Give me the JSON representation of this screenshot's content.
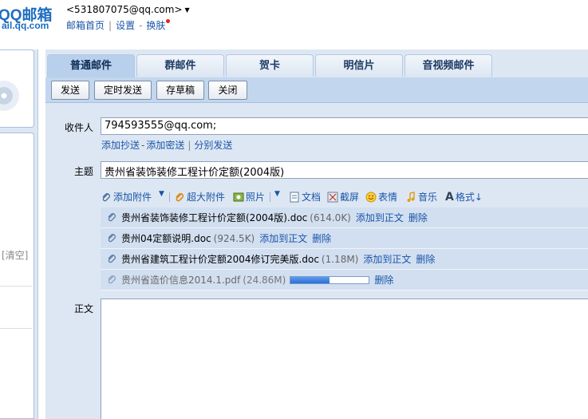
{
  "header": {
    "logo_main": "QQ邮箱",
    "logo_sub": "ail.qq.com",
    "account": "<531807075@qq.com>",
    "links": [
      "邮箱首页",
      "设置",
      "换肤"
    ]
  },
  "sidebar": {
    "clear_label": "[清空]"
  },
  "tabs": [
    {
      "label": "普通邮件",
      "active": true
    },
    {
      "label": "群邮件",
      "active": false
    },
    {
      "label": "贺卡",
      "active": false
    },
    {
      "label": "明信片",
      "active": false
    },
    {
      "label": "音视频邮件",
      "active": false
    }
  ],
  "toolbar": {
    "send": "发送",
    "scheduled_send": "定时发送",
    "save_draft": "存草稿",
    "close": "关闭"
  },
  "compose": {
    "to_label": "收件人",
    "to_value": "794593555@qq.com;",
    "to_links": [
      "添加抄送",
      "添加密送",
      "分别发送"
    ],
    "subject_label": "主题",
    "subject_value": "贵州省装饰装修工程计价定额(2004版)",
    "body_label": "正文"
  },
  "attach_toolbar": {
    "add_attachment": "添加附件",
    "large_attachment": "超大附件",
    "photo": "照片",
    "document": "文档",
    "screenshot": "截屏",
    "emoticon": "表情",
    "music": "音乐",
    "format": "格式"
  },
  "attachments": [
    {
      "name": "贵州省装饰装修工程计价定额(2004版).doc",
      "size": "(614.0K)",
      "insert": "添加到正文",
      "delete": "删除"
    },
    {
      "name": "贵州04定额说明.doc",
      "size": "(924.5K)",
      "insert": "添加到正文",
      "delete": "删除"
    },
    {
      "name": "贵州省建筑工程计价定额2004修订完美版.doc",
      "size": "(1.18M)",
      "insert": "添加到正文",
      "delete": "删除"
    },
    {
      "name": "贵州省造价信息2014.1.pdf",
      "size": "(24.86M)",
      "delete": "删除",
      "progress": 0.5
    }
  ],
  "colors": {
    "brand_blue": "#1e6dbf",
    "link_blue": "#1a55a8",
    "panel_bg": "#dde7f3",
    "notify_dot": "#e3231a"
  }
}
